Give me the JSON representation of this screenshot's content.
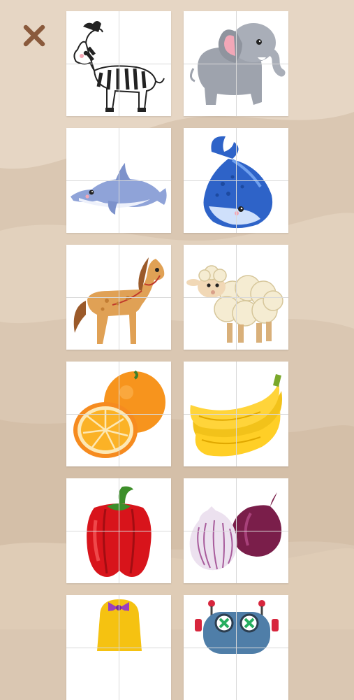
{
  "screen": {
    "background_color": "#dac7b2",
    "accent_color": "#8a5a3c"
  },
  "close": {
    "icon": "close-icon"
  },
  "puzzles": [
    {
      "id": "zebra",
      "icon": "zebra-icon"
    },
    {
      "id": "elephant",
      "icon": "elephant-icon"
    },
    {
      "id": "dolphin",
      "icon": "dolphin-icon"
    },
    {
      "id": "whale",
      "icon": "whale-icon"
    },
    {
      "id": "horse",
      "icon": "horse-icon"
    },
    {
      "id": "sheep",
      "icon": "sheep-icon"
    },
    {
      "id": "orange",
      "icon": "orange-icon"
    },
    {
      "id": "banana",
      "icon": "banana-icon"
    },
    {
      "id": "pepper",
      "icon": "bell-pepper-icon"
    },
    {
      "id": "onion",
      "icon": "onion-icon"
    },
    {
      "id": "girl",
      "icon": "girl-icon"
    },
    {
      "id": "robot",
      "icon": "robot-icon"
    }
  ]
}
